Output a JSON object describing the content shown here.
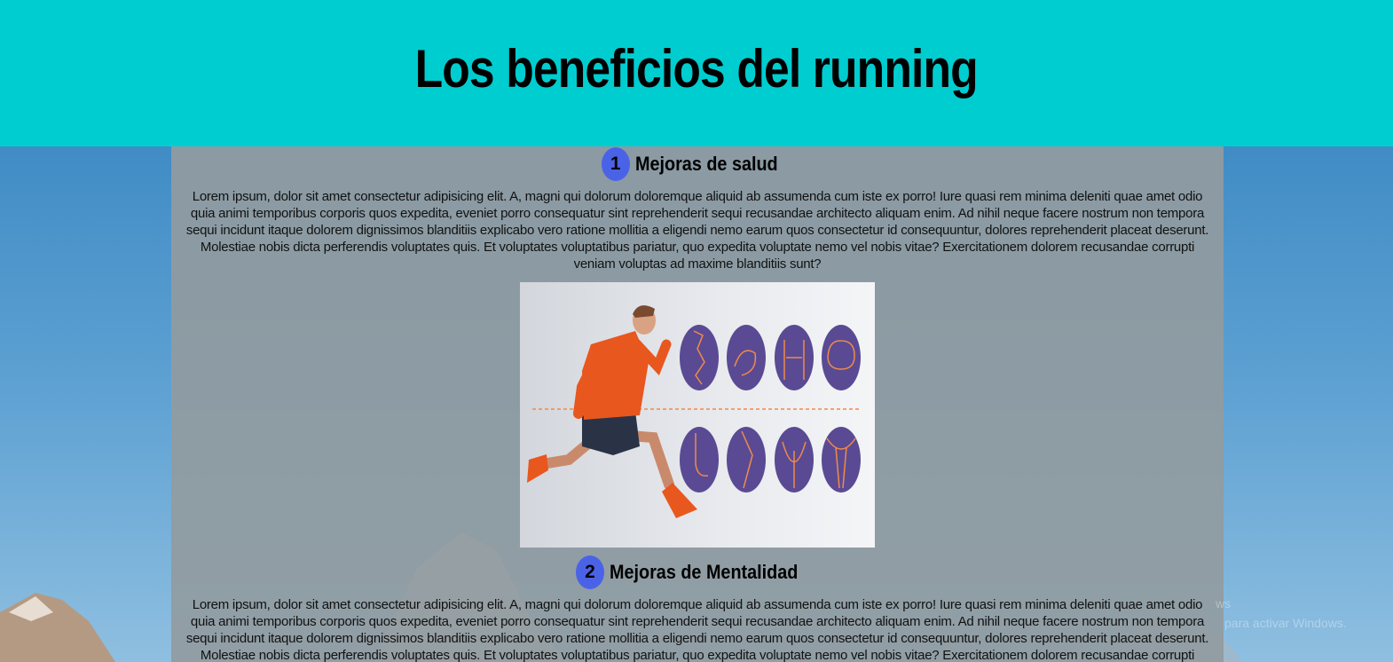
{
  "header": {
    "title": "Los beneficios del running"
  },
  "sections": [
    {
      "number": "1",
      "title": "Mejoras de salud",
      "text": "Lorem ipsum, dolor sit amet consectetur adipisicing elit. A, magni qui dolorum doloremque aliquid ab assumenda cum iste ex porro! Iure quasi rem minima deleniti quae amet odio quia animi temporibus corporis quos expedita, eveniet porro consequatur sint reprehenderit sequi recusandae architecto aliquam enim. Ad nihil neque facere nostrum non tempora sequi incidunt itaque dolorem dignissimos blanditiis explicabo vero ratione mollitia a eligendi nemo earum quos consectetur id consequuntur, dolores reprehenderit placeat deserunt. Molestiae nobis dicta perferendis voluptates quis. Et voluptates voluptatibus pariatur, quo expedita voluptate nemo vel nobis vitae? Exercitationem dolorem recusandae corrupti veniam voluptas ad maxime blanditiis sunt?",
      "image": "runner-body-benefits-illustration"
    },
    {
      "number": "2",
      "title": "Mejoras de Mentalidad",
      "text": "Lorem ipsum, dolor sit amet consectetur adipisicing elit. A, magni qui dolorum doloremque aliquid ab assumenda cum iste ex porro! Iure quasi rem minima deleniti quae amet odio quia animi temporibus corporis quos expedita, eveniet porro consequatur sint reprehenderit sequi recusandae architecto aliquam enim. Ad nihil neque facere nostrum non tempora sequi incidunt itaque dolorem dignissimos blanditiis explicabo vero ratione mollitia a eligendi nemo earum quos consectetur id consequuntur, dolores reprehenderit placeat deserunt. Molestiae nobis dicta perferendis voluptates quis. Et voluptates voluptatibus pariatur, quo expedita voluptate nemo vel nobis vitae? Exercitationem dolorem recusandae corrupti veniam"
    }
  ],
  "watermark": {
    "line1": "ws",
    "line2": "para activar Windows."
  },
  "colors": {
    "header_bg": "#00cdd0",
    "badge": "#4a63e6",
    "content_bg": "#919ba0",
    "runner_shirt": "#e8571e",
    "icon_circle": "#5a4a93",
    "icon_line": "#f08a4b"
  }
}
